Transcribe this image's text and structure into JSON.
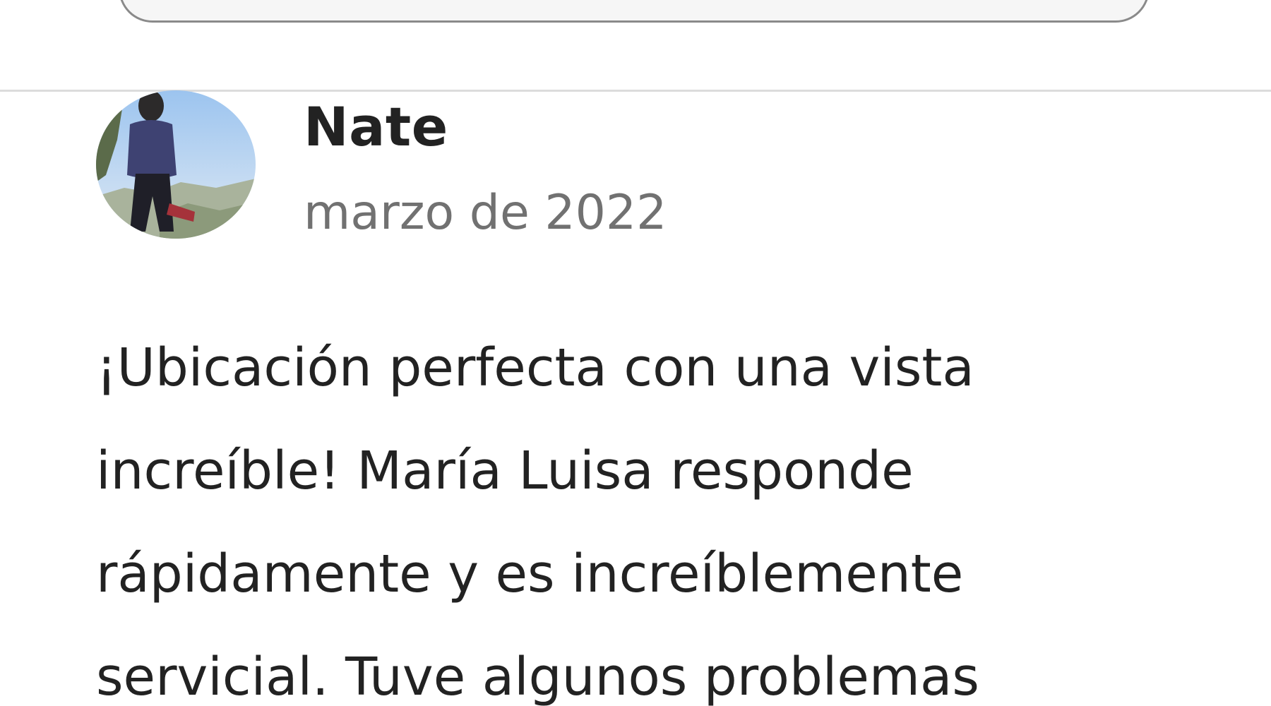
{
  "review": {
    "reviewer_name": "Nate",
    "date": "marzo de 2022",
    "text_lines": [
      "¡Ubicación perfecta con una vista",
      "increíble! María Luisa responde",
      "rápidamente y es increíblemente",
      "servicial. Tuve algunos problemas"
    ]
  },
  "colors": {
    "primary_text": "#222222",
    "secondary_text": "#717171",
    "divider": "#dcdcdc",
    "search_border": "#8a8a8a"
  }
}
